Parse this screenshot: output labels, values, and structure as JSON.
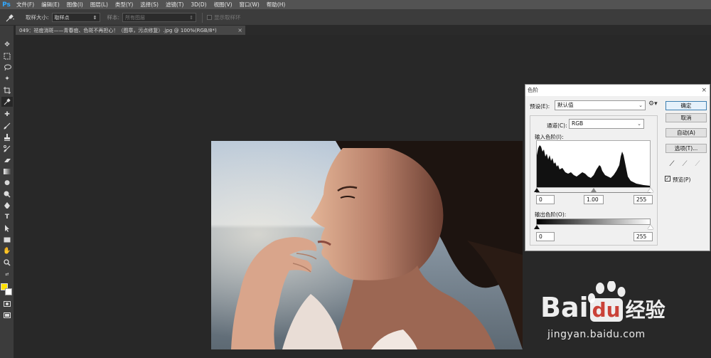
{
  "menu": {
    "logo": "Ps",
    "items": [
      "文件(F)",
      "编辑(E)",
      "图像(I)",
      "图层(L)",
      "类型(Y)",
      "选择(S)",
      "滤镜(T)",
      "3D(D)",
      "视图(V)",
      "窗口(W)",
      "帮助(H)"
    ]
  },
  "options": {
    "sample_size_label": "取样大小:",
    "sample_size_value": "取样点",
    "sample_label": "样本:",
    "sample_value": "所有图层",
    "show_ring_label": "显示取样环"
  },
  "document": {
    "tab_title": "049：祛痘消斑——青春痘、色斑不再担心！（图章，污点修复）.jpg @ 100%(RGB/8*)",
    "close_glyph": "×"
  },
  "levels": {
    "title": "色阶",
    "close_glyph": "×",
    "preset_label": "预设(E):",
    "preset_value": "默认值",
    "channel_label": "通道(C):",
    "channel_value": "RGB",
    "input_label": "输入色阶(I):",
    "input_black": "0",
    "input_gamma": "1.00",
    "input_white": "255",
    "output_label": "输出色阶(O):",
    "output_black": "0",
    "output_white": "255",
    "btn_ok": "确定",
    "btn_cancel": "取消",
    "btn_auto": "自动(A)",
    "btn_options": "选项(T)...",
    "preview_label": "预览(P)",
    "preview_checked": true
  },
  "watermark": {
    "brand_left": "Bai",
    "brand_right": "du",
    "brand_cn": "经验",
    "url": "jingyan.baidu.com"
  },
  "colors": {
    "foreground": "#ffe000",
    "background": "#ffffff",
    "accent": "#31a8ff"
  }
}
